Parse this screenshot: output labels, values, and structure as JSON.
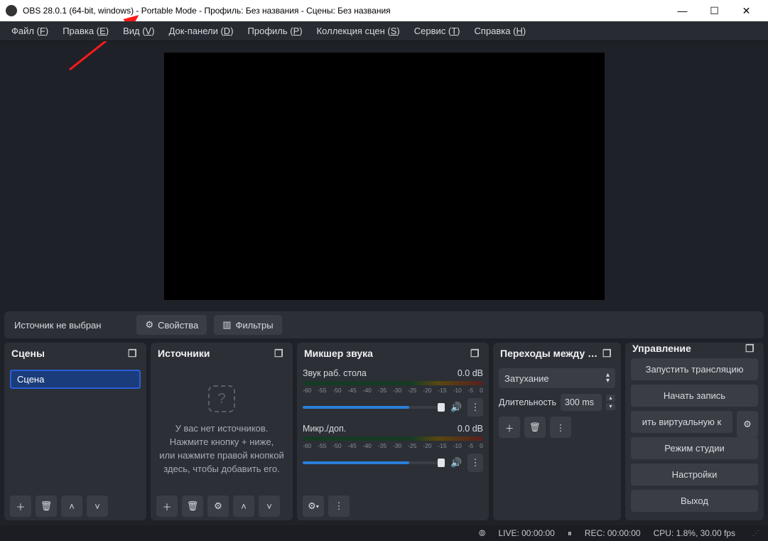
{
  "titlebar": {
    "text": "OBS 28.0.1 (64-bit, windows) - Portable Mode - Профиль: Без названия - Сцены: Без названия"
  },
  "menubar": [
    {
      "label": "Файл",
      "hotkey": "F"
    },
    {
      "label": "Правка",
      "hotkey": "E"
    },
    {
      "label": "Вид",
      "hotkey": "V"
    },
    {
      "label": "Док-панели",
      "hotkey": "D"
    },
    {
      "label": "Профиль",
      "hotkey": "P"
    },
    {
      "label": "Коллекция сцен",
      "hotkey": "S"
    },
    {
      "label": "Сервис",
      "hotkey": "T"
    },
    {
      "label": "Справка",
      "hotkey": "H"
    }
  ],
  "toolbar": {
    "no_source_label": "Источник не выбран",
    "properties_label": "Свойства",
    "filters_label": "Фильтры"
  },
  "panels": {
    "scenes": {
      "title": "Сцены",
      "items": [
        "Сцена"
      ]
    },
    "sources": {
      "title": "Источники",
      "empty_lines": [
        "У вас нет источников.",
        "Нажмите кнопку + ниже,",
        "или нажмите правой кнопкой",
        "здесь, чтобы добавить его."
      ]
    },
    "mixer": {
      "title": "Микшер звука",
      "channels": [
        {
          "name": "Звук раб. стола",
          "level": "0.0 dB"
        },
        {
          "name": "Микр./доп.",
          "level": "0.0 dB"
        }
      ],
      "ticks": [
        "-60",
        "-55",
        "-50",
        "-45",
        "-40",
        "-35",
        "-30",
        "-25",
        "-20",
        "-15",
        "-10",
        "-5",
        "0"
      ]
    },
    "transitions": {
      "title": "Переходы между …",
      "selected": "Затухание",
      "duration_label": "Длительность",
      "duration_value": "300 ms"
    },
    "controls": {
      "title": "Управление",
      "buttons": {
        "start_stream": "Запустить трансляцию",
        "start_record": "Начать запись",
        "virtual_cam": "ить виртуальную к",
        "studio": "Режим студии",
        "settings": "Настройки",
        "exit": "Выход"
      }
    }
  },
  "status": {
    "live": "LIVE: 00:00:00",
    "rec": "REC: 00:00:00",
    "cpu": "CPU: 1.8%, 30.00 fps"
  }
}
